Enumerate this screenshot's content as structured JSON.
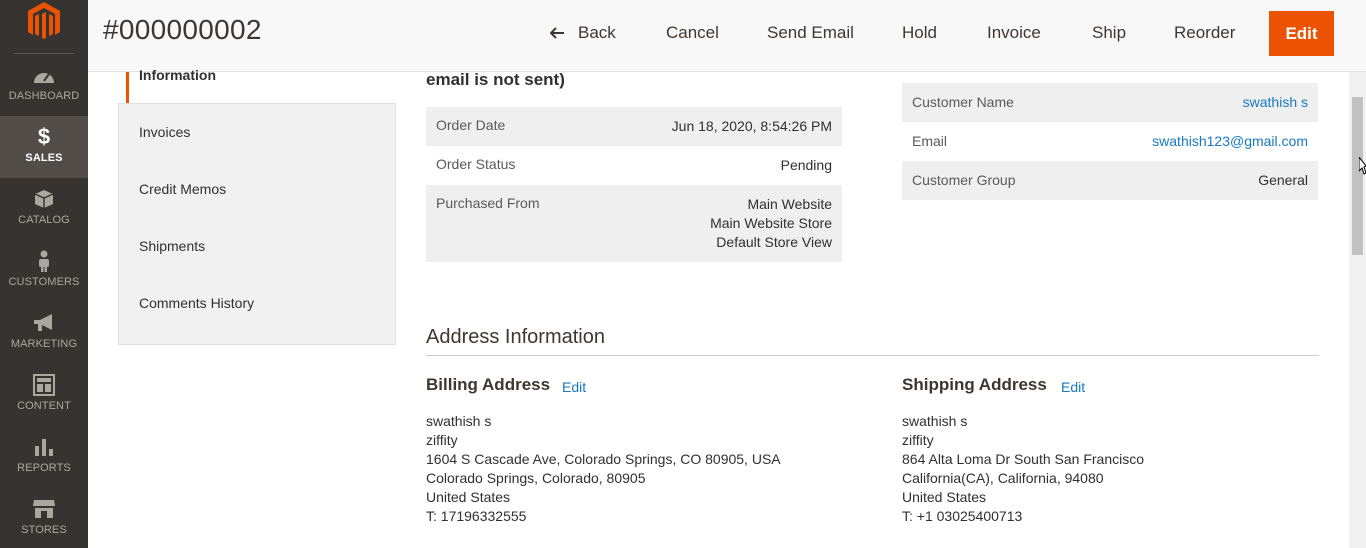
{
  "sidebar": {
    "items": [
      {
        "label": "DASHBOARD",
        "icon": "dashboard-icon",
        "active": false
      },
      {
        "label": "SALES",
        "icon": "dollar-icon",
        "active": true
      },
      {
        "label": "CATALOG",
        "icon": "catalog-box-icon",
        "active": false
      },
      {
        "label": "CUSTOMERS",
        "icon": "customer-person-icon",
        "active": false
      },
      {
        "label": "MARKETING",
        "icon": "megaphone-icon",
        "active": false
      },
      {
        "label": "CONTENT",
        "icon": "content-layout-icon",
        "active": false
      },
      {
        "label": "REPORTS",
        "icon": "bar-chart-icon",
        "active": false
      },
      {
        "label": "STORES",
        "icon": "store-icon",
        "active": false
      }
    ],
    "dollar_glyph": "$"
  },
  "header": {
    "title": "#000000002",
    "buttons": {
      "back": "Back",
      "cancel": "Cancel",
      "send_email": "Send Email",
      "hold": "Hold",
      "invoice": "Invoice",
      "ship": "Ship",
      "reorder": "Reorder",
      "edit": "Edit"
    }
  },
  "tabs": {
    "active": "Information",
    "items": [
      "Invoices",
      "Credit Memos",
      "Shipments",
      "Comments History"
    ]
  },
  "order": {
    "note": "email is not sent)",
    "rows": [
      {
        "label": "Order Date",
        "value": "Jun 18, 2020, 8:54:26 PM"
      },
      {
        "label": "Order Status",
        "value": "Pending"
      },
      {
        "label": "Purchased From",
        "value_lines": [
          "Main Website",
          "Main Website Store",
          "Default Store View"
        ]
      }
    ]
  },
  "customer": {
    "rows": [
      {
        "label": "Customer Name",
        "value": "swathish s",
        "link": true
      },
      {
        "label": "Email",
        "value": "swathish123@gmail.com",
        "link": true
      },
      {
        "label": "Customer Group",
        "value": "General",
        "link": false
      }
    ]
  },
  "address": {
    "section_title": "Address Information",
    "edit_label": "Edit",
    "billing": {
      "title": "Billing Address",
      "lines": [
        "swathish s",
        "ziffity",
        "1604 S Cascade Ave, Colorado Springs, CO 80905, USA",
        "Colorado Springs, Colorado, 80905",
        "United States",
        "T: 17196332555"
      ]
    },
    "shipping": {
      "title": "Shipping Address",
      "lines": [
        "swathish s",
        "ziffity",
        "864 Alta Loma Dr South San Francisco",
        "California(CA), California, 94080",
        "United States",
        "T: +1 03025400713"
      ]
    }
  },
  "colors": {
    "accent": "#eb5202",
    "link": "#1979c3",
    "sidebar_bg": "#373330"
  }
}
